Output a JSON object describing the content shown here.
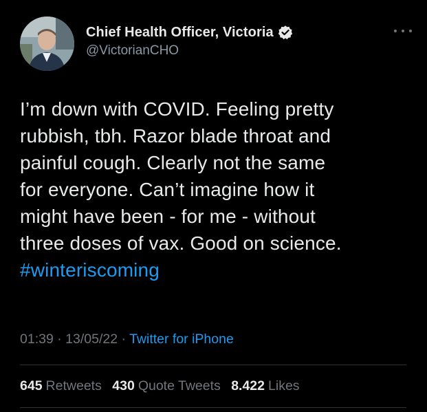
{
  "tweet": {
    "author": {
      "display_name": "Chief Health Officer, Victoria",
      "handle": "@VictorianCHO",
      "verified": true,
      "avatar": "profile-photo"
    },
    "body_lines": [
      "I’m down with COVID. Feeling pretty",
      "rubbish, tbh. Razor blade throat and",
      "painful cough. Clearly not the same",
      "for everyone. Can’t imagine how it",
      "might have been - for me - without",
      "three doses of vax. Good on science."
    ],
    "hashtag": "#winteriscoming",
    "time": "01:39",
    "separator": "·",
    "date": "13/05/22",
    "source": "Twitter for iPhone",
    "stats": {
      "retweets_count": "645",
      "retweets_label": "Retweets",
      "quote_count": "430",
      "quote_label": "Quote Tweets",
      "likes_count": "8.422",
      "likes_label": "Likes"
    },
    "more_icon": "more-horizontal-icon"
  },
  "colors": {
    "background": "#000000",
    "text": "#e7e9ea",
    "secondary": "#71767b",
    "accent": "#1d9bf0",
    "divider": "#2f3336"
  }
}
